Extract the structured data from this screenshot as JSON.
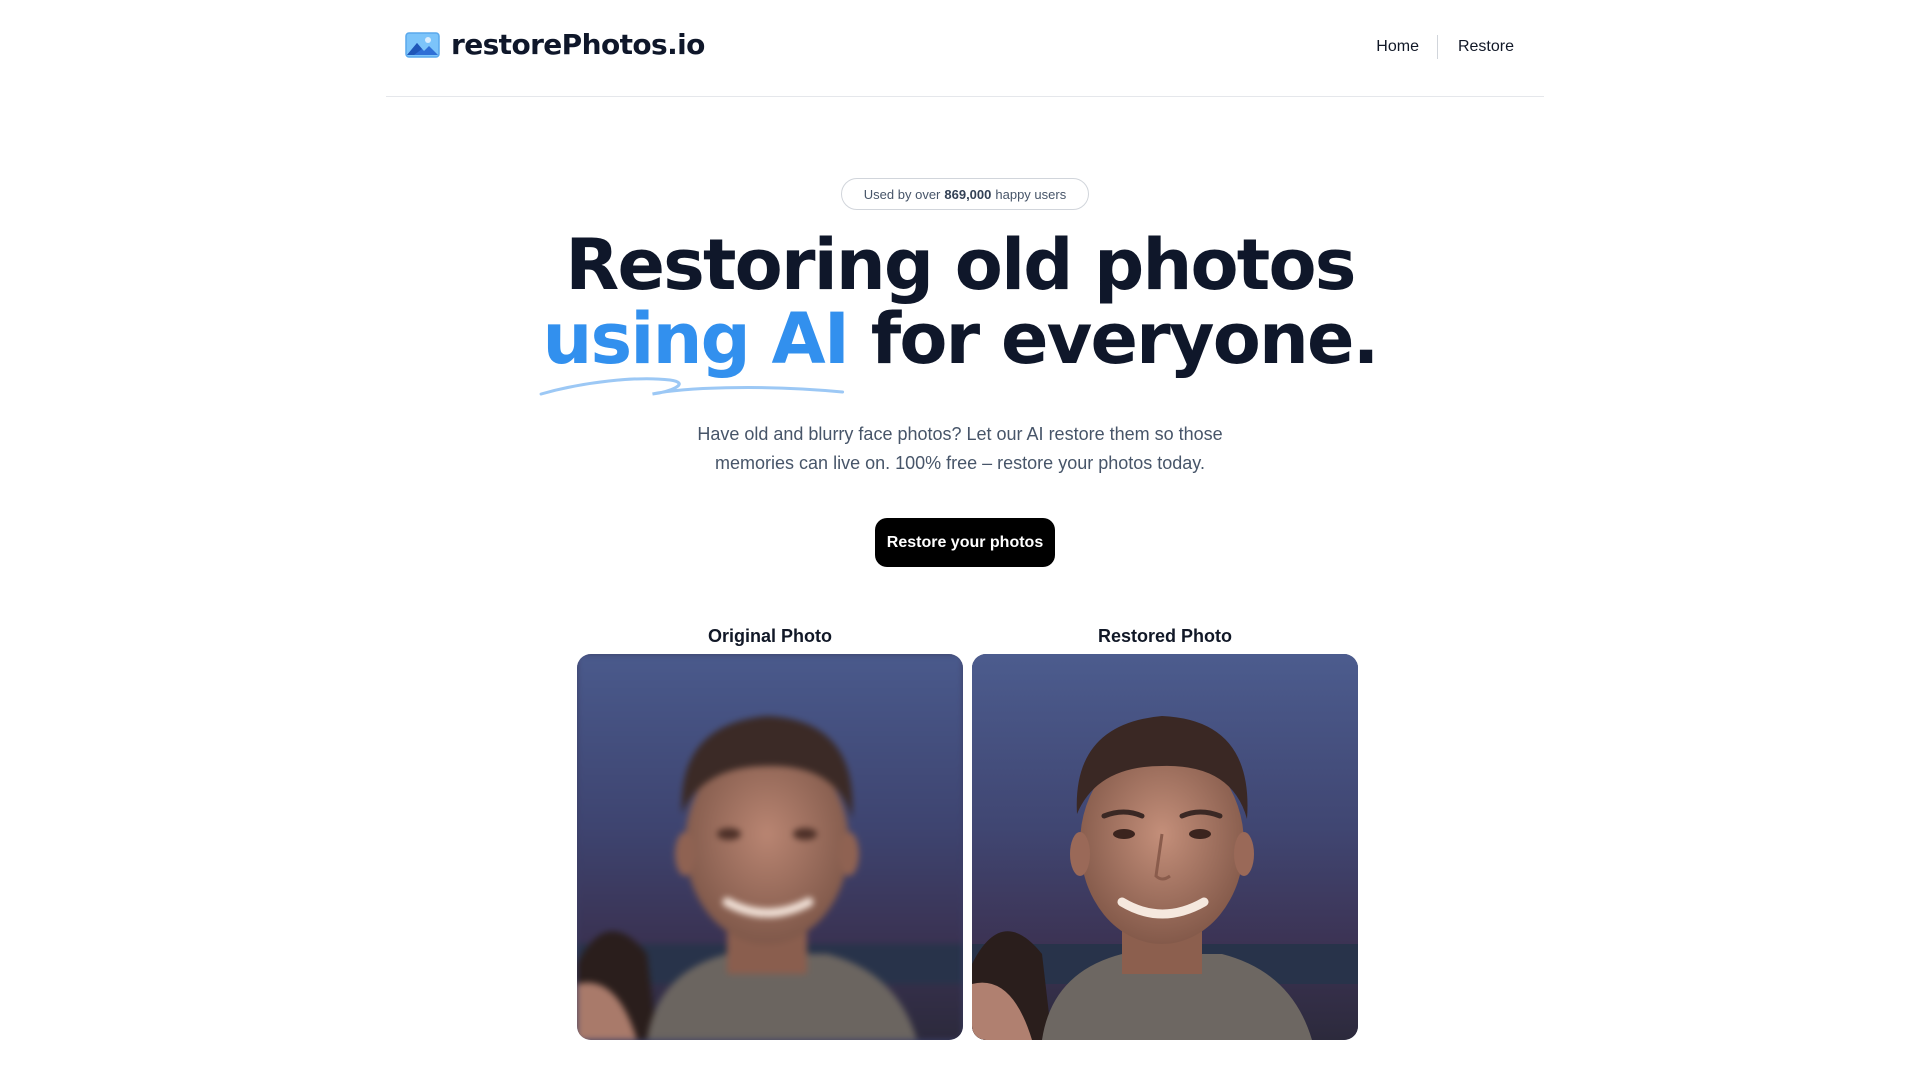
{
  "header": {
    "brand_name": "restorePhotos.io",
    "nav": {
      "home_label": "Home",
      "restore_label": "Restore"
    }
  },
  "hero": {
    "badge": {
      "prefix": "Used by over",
      "count": "869,000",
      "suffix": "happy users"
    },
    "headline": {
      "line1": "Restoring old photos",
      "accent": "using AI",
      "rest": "for everyone."
    },
    "description": {
      "line1": "Have old and blurry face photos? Let our AI restore them so those",
      "line2": "memories can live on. 100% free – restore your photos today."
    },
    "cta_label": "Restore your photos"
  },
  "comparison": {
    "original_label": "Original Photo",
    "restored_label": "Restored Photo"
  },
  "colors": {
    "accent": "#3290ee",
    "text": "#0f172a",
    "muted": "#475569",
    "button_bg": "#000000"
  }
}
